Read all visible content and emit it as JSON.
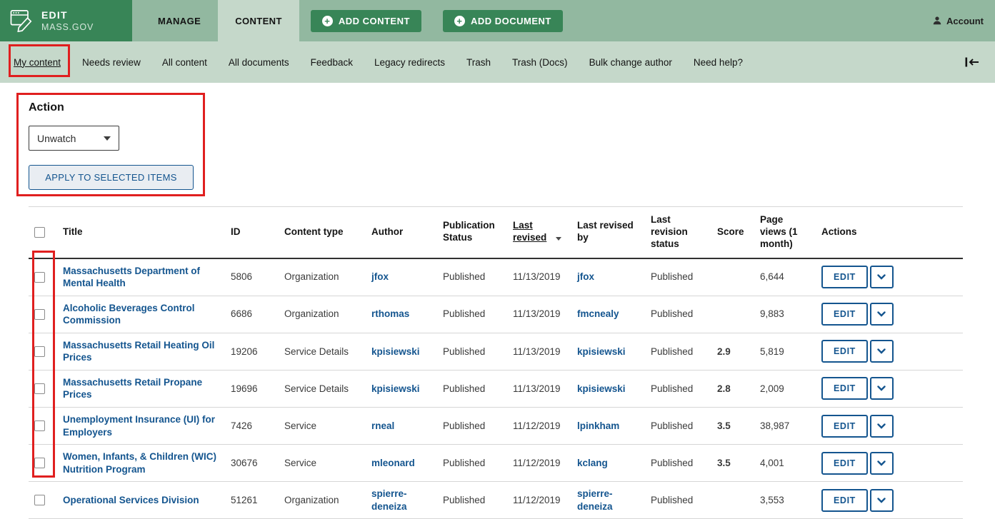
{
  "header": {
    "logo_line1": "EDIT",
    "logo_line2": "MASS.GOV",
    "tab_manage": "MANAGE",
    "tab_content": "CONTENT",
    "add_content": "ADD CONTENT",
    "add_document": "ADD DOCUMENT",
    "account": "Account"
  },
  "subnav": {
    "items": [
      {
        "label": "My content"
      },
      {
        "label": "Needs review"
      },
      {
        "label": "All content"
      },
      {
        "label": "All documents"
      },
      {
        "label": "Feedback"
      },
      {
        "label": "Legacy redirects"
      },
      {
        "label": "Trash"
      },
      {
        "label": "Trash (Docs)"
      },
      {
        "label": "Bulk change author"
      },
      {
        "label": "Need help?"
      }
    ]
  },
  "action_panel": {
    "heading": "Action",
    "dropdown_value": "Unwatch",
    "apply_button": "APPLY TO SELECTED ITEMS"
  },
  "table": {
    "headers": {
      "title": "Title",
      "id": "ID",
      "content_type": "Content type",
      "author": "Author",
      "publication_status": "Publication Status",
      "last_revised": "Last revised",
      "last_revised_by": "Last revised by",
      "last_revision_status": "Last revision status",
      "score": "Score",
      "page_views": "Page views (1 month)",
      "actions": "Actions"
    },
    "edit_button": "EDIT",
    "rows": [
      {
        "title": "Massachusetts Department of Mental Health",
        "id": "5806",
        "content_type": "Organization",
        "author": "jfox",
        "publication_status": "Published",
        "last_revised": "11/13/2019",
        "last_revised_by": "jfox",
        "last_revision_status": "Published",
        "score": "",
        "page_views": "6,644"
      },
      {
        "title": "Alcoholic Beverages Control Commission",
        "id": "6686",
        "content_type": "Organization",
        "author": "rthomas",
        "publication_status": "Published",
        "last_revised": "11/13/2019",
        "last_revised_by": "fmcnealy",
        "last_revision_status": "Published",
        "score": "",
        "page_views": "9,883"
      },
      {
        "title": "Massachusetts Retail Heating Oil Prices",
        "id": "19206",
        "content_type": "Service Details",
        "author": "kpisiewski",
        "publication_status": "Published",
        "last_revised": "11/13/2019",
        "last_revised_by": "kpisiewski",
        "last_revision_status": "Published",
        "score": "2.9",
        "page_views": "5,819"
      },
      {
        "title": "Massachusetts Retail Propane Prices",
        "id": "19696",
        "content_type": "Service Details",
        "author": "kpisiewski",
        "publication_status": "Published",
        "last_revised": "11/13/2019",
        "last_revised_by": "kpisiewski",
        "last_revision_status": "Published",
        "score": "2.8",
        "page_views": "2,009"
      },
      {
        "title": "Unemployment Insurance (UI) for Employers",
        "id": "7426",
        "content_type": "Service",
        "author": "rneal",
        "publication_status": "Published",
        "last_revised": "11/12/2019",
        "last_revised_by": "lpinkham",
        "last_revision_status": "Published",
        "score": "3.5",
        "page_views": "38,987"
      },
      {
        "title": "Women, Infants, & Children (WIC) Nutrition Program",
        "id": "30676",
        "content_type": "Service",
        "author": "mleonard",
        "publication_status": "Published",
        "last_revised": "11/12/2019",
        "last_revised_by": "kclang",
        "last_revision_status": "Published",
        "score": "3.5",
        "page_views": "4,001"
      },
      {
        "title": "Operational Services Division",
        "id": "51261",
        "content_type": "Organization",
        "author": "spierre-deneiza",
        "publication_status": "Published",
        "last_revised": "11/12/2019",
        "last_revised_by": "spierre-deneiza",
        "last_revision_status": "Published",
        "score": "",
        "page_views": "3,553"
      }
    ]
  },
  "colors": {
    "header_green": "#92b8a0",
    "brand_green": "#388557",
    "subnav_green": "#c5d8ca",
    "link_blue": "#14558f",
    "annotation_red": "#e01f1f"
  }
}
